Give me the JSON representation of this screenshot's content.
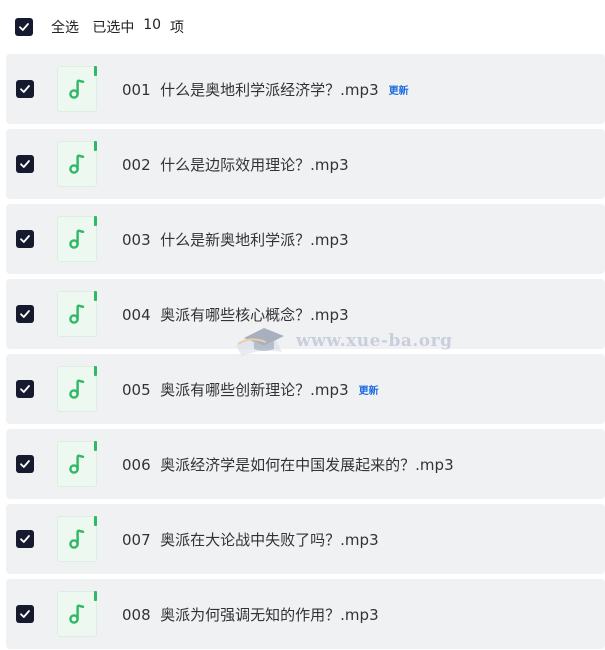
{
  "header": {
    "select_all_label": "全选",
    "selected_prefix": "已选中",
    "selected_count": "10",
    "selected_suffix": "项"
  },
  "items": [
    {
      "title": "001  什么是奥地利学派经济学？.mp3",
      "badge": "更新"
    },
    {
      "title": "002  什么是边际效用理论？.mp3",
      "badge": ""
    },
    {
      "title": "003  什么是新奥地利学派？.mp3",
      "badge": ""
    },
    {
      "title": "004  奥派有哪些核心概念？.mp3",
      "badge": ""
    },
    {
      "title": "005  奥派有哪些创新理论？.mp3",
      "badge": "更新"
    },
    {
      "title": "006  奥派经济学是如何在中国发展起来的？.mp3",
      "badge": ""
    },
    {
      "title": "007  奥派在大论战中失败了吗？.mp3",
      "badge": ""
    },
    {
      "title": "008  奥派为何强调无知的作用？.mp3",
      "badge": ""
    }
  ],
  "icons": {
    "checkbox": "checkbox-checked-icon",
    "file": "music-note-icon"
  },
  "colors": {
    "checkbox": "#161a2e",
    "row_bg": "#f0f1f3",
    "accent_green": "#2fb865",
    "badge_blue": "#1f6fe0"
  },
  "watermark": {
    "text": "www.xue-ba.org"
  }
}
